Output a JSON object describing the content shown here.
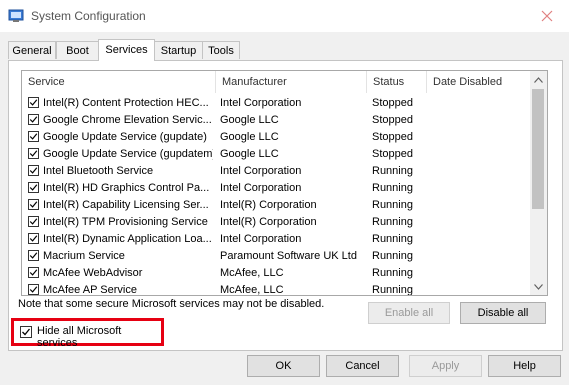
{
  "window": {
    "title": "System Configuration"
  },
  "tabs": [
    "General",
    "Boot",
    "Services",
    "Startup",
    "Tools"
  ],
  "active_tab": "Services",
  "columns": [
    "Service",
    "Manufacturer",
    "Status",
    "Date Disabled"
  ],
  "services": [
    {
      "name": "Intel(R) Content Protection HEC...",
      "manufacturer": "Intel Corporation",
      "status": "Stopped",
      "checked": true
    },
    {
      "name": "Google Chrome Elevation Servic...",
      "manufacturer": "Google LLC",
      "status": "Stopped",
      "checked": true
    },
    {
      "name": "Google Update Service (gupdate)",
      "manufacturer": "Google LLC",
      "status": "Stopped",
      "checked": true
    },
    {
      "name": "Google Update Service (gupdatem)",
      "manufacturer": "Google LLC",
      "status": "Stopped",
      "checked": true
    },
    {
      "name": "Intel Bluetooth Service",
      "manufacturer": "Intel Corporation",
      "status": "Running",
      "checked": true
    },
    {
      "name": "Intel(R) HD Graphics Control Pa...",
      "manufacturer": "Intel Corporation",
      "status": "Running",
      "checked": true
    },
    {
      "name": "Intel(R) Capability Licensing Ser...",
      "manufacturer": "Intel(R) Corporation",
      "status": "Running",
      "checked": true
    },
    {
      "name": "Intel(R) TPM Provisioning Service",
      "manufacturer": "Intel(R) Corporation",
      "status": "Running",
      "checked": true
    },
    {
      "name": "Intel(R) Dynamic Application Loa...",
      "manufacturer": "Intel Corporation",
      "status": "Running",
      "checked": true
    },
    {
      "name": "Macrium Service",
      "manufacturer": "Paramount Software UK Ltd",
      "status": "Running",
      "checked": true
    },
    {
      "name": "McAfee WebAdvisor",
      "manufacturer": "McAfee, LLC",
      "status": "Running",
      "checked": true
    },
    {
      "name": "McAfee AP Service",
      "manufacturer": "McAfee, LLC",
      "status": "Running",
      "checked": true
    }
  ],
  "note": "Note that some secure Microsoft services may not be disabled.",
  "buttons": {
    "enable_all": "Enable all",
    "disable_all": "Disable all",
    "ok": "OK",
    "cancel": "Cancel",
    "apply": "Apply",
    "help": "Help"
  },
  "hide_ms": {
    "label": "Hide all Microsoft services",
    "checked": true
  },
  "colors": {
    "highlight": "#e60012"
  }
}
